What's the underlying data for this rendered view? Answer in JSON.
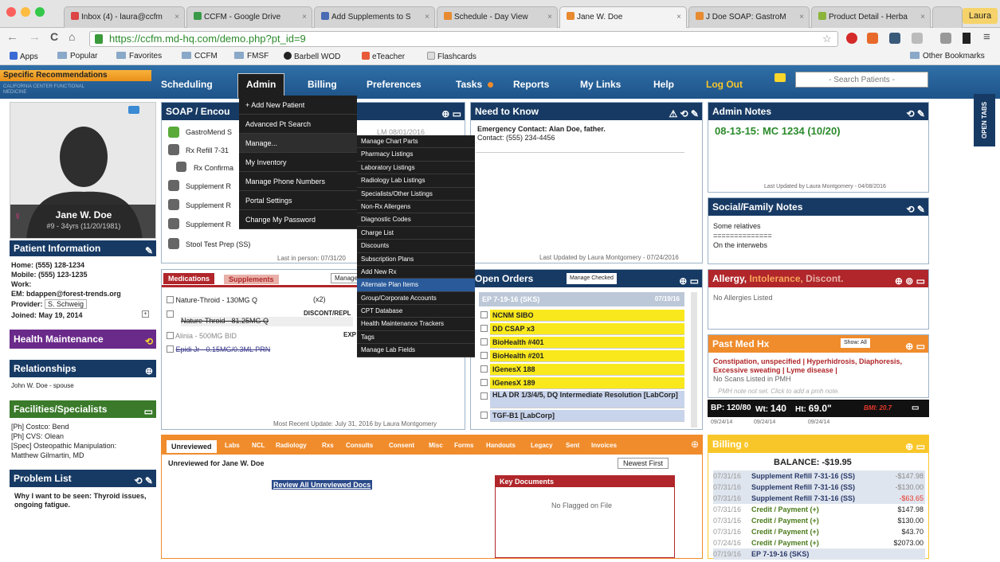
{
  "browser": {
    "tabs": [
      "Inbox (4) - laura@ccfm",
      "CCFM - Google Drive",
      "Add Supplements to S",
      "Schedule - Day View",
      "Jane W. Doe",
      "J Doe SOAP: GastroM",
      "Product Detail - Herba"
    ],
    "profile": "Laura",
    "url": "https://ccfm.md-hq.com/demo.php?pt_id=9"
  },
  "bookmarks": [
    "Apps",
    "Popular",
    "Favorites",
    "CCFM",
    "FMSF",
    "Barbell WOD",
    "eTeacher",
    "Flashcards",
    "Other Bookmarks"
  ],
  "logo": {
    "banner": "Specific Recommendations",
    "sub": "CALIFORNIA CENTER FUNCTIONAL MEDICINE"
  },
  "nav": [
    "Scheduling",
    "Admin",
    "Billing",
    "Preferences",
    "Tasks",
    "Reports",
    "My Links",
    "Help",
    "Log Out"
  ],
  "search_placeholder": "- Search Patients -",
  "open_tabs": "OPEN TABS",
  "patient": {
    "name": "Jane W. Doe",
    "id": "#9 - 34yrs (11/20/1981)"
  },
  "patient_info": {
    "title": "Patient Information",
    "home": "Home: (555) 128-1234",
    "mobile": "Mobile: (555) 123-1235",
    "work": "Work:",
    "em": "EM: bdappen@forest-trends.org",
    "provider_label": "Provider:",
    "provider": "S. Schweig",
    "joined": "Joined: May 19, 2014"
  },
  "health_maintenance": "Health Maintenance",
  "relationships": {
    "title": "Relationships",
    "item": "John W. Doe - spouse"
  },
  "facilities": {
    "title": "Facilities/Specialists",
    "items": [
      "[Ph] Costco: Bend",
      "[Ph] CVS: Olean",
      "[Spec] Osteopathic Manipulation:",
      "Matthew Gilmartin, MD"
    ]
  },
  "problem_list": {
    "title": "Problem List",
    "text": "Why I want to be seen: Thyroid issues, ongoing fatigue."
  },
  "soap": {
    "title": "SOAP / Encou",
    "items": [
      "GastroMend S",
      "Rx Refill 7-31",
      "Rx Confirma",
      "Supplement R",
      "Supplement R",
      "Supplement R",
      "Stool Test Prep (SS)"
    ],
    "date": "LM 08/01/2016",
    "footer": "Last in person: 07/31/20"
  },
  "admin_menu": [
    "+ Add New Patient",
    "Advanced Pt Search",
    "Manage...",
    "My Inventory",
    "Manage Phone Numbers",
    "Portal Settings",
    "Change My Password"
  ],
  "manage_menu": [
    "Manage Chart Parts",
    "Pharmacy Listings",
    "Laboratory Listings",
    "Radiology Lab Listings",
    "Specialists/Other Listings",
    "Non-Rx Allergens",
    "Diagnostic Codes",
    "Charge List",
    "Discounts",
    "Subscription Plans",
    "Add New Rx",
    "Alternate Plan Items",
    "Group/Corporate Accounts",
    "CPT Database",
    "Health Maintenance Trackers",
    "Tags",
    "Manage Lab Fields"
  ],
  "meds": {
    "tabs": [
      "Medications",
      "Supplements"
    ],
    "manage": "Manage",
    "items": [
      "Nature-Throid - 130MG Q",
      "Nature-Throid - 81.25MG Q",
      "Alinia - 500MG BID",
      "Epidi Jr - 0.15MG/0.3ML PRN"
    ],
    "x2": "(x2)",
    "discont": "DISCONT/REPL",
    "exp": "EXP",
    "footer": "Most Recent Update: July 31, 2016 by Laura Montgomery"
  },
  "need_to_know": {
    "title": "Need to Know",
    "contact": "Emergency Contact: Alan Doe, father.",
    "phone": "Contact: (555) 234-4456",
    "footer": "Last Updated by Laura Montgomery - 07/24/2016"
  },
  "admin_notes": {
    "title": "Admin Notes",
    "text": "08-13-15: MC 1234 (10/20)",
    "footer": "Last Updated by Laura Montgomery - 04/08/2016"
  },
  "social": {
    "title": "Social/Family Notes",
    "lines": [
      "Some relatives",
      "==============",
      "On the interwebs"
    ]
  },
  "orders": {
    "title": "Open Orders",
    "manage": "Manage Checked",
    "group": "EP 7-19-16 (SKS)",
    "group_date": "07/19/16",
    "items": [
      "NCNM SIBO",
      "DD CSAP x3",
      "BioHealth #401",
      "BioHealth #201",
      "IGenesX 188",
      "IGenesX 189",
      "HLA DR 1/3/4/5, DQ Intermediate Resolution [LabCorp]",
      "TGF-B1 [LabCorp]"
    ]
  },
  "allergy": {
    "title_a": "Allergy, ",
    "title_b": "Intolerance, ",
    "title_c": "Discont.",
    "text": "No Allergies Listed"
  },
  "pmh": {
    "title": "Past Med Hx",
    "show": "Show: All",
    "text": "Constipation, unspecified | Hyperhidrosis, Diaphoresis, Excessive sweating | Lyme disease |",
    "scans": "No Scans Listed in PMH",
    "note": "PMH note not set. Click to add a pmh note."
  },
  "vitals": {
    "bp": "BP: 120/80",
    "wt_label": "Wt:",
    "wt": "140",
    "ht_label": "Ht:",
    "ht": "69.0\"",
    "bmi": "BMI: 20.7",
    "dates": [
      "09/24/14",
      "09/24/14",
      "09/24/14"
    ]
  },
  "docs": {
    "tabs": [
      "Unreviewed",
      "Labs",
      "NCL",
      "Radiology",
      "Rxs",
      "Consults",
      "Consent",
      "Misc",
      "Forms",
      "Handouts",
      "Legacy",
      "Sent",
      "Invoices"
    ],
    "heading": "Unreviewed for Jane W. Doe",
    "sort": "Newest First",
    "review": "Review All Unreviewed Docs",
    "key_title": "Key Documents",
    "key_empty": "No Flagged on File"
  },
  "billing": {
    "title": "Billing",
    "count": "0",
    "balance": "BALANCE: -$19.95",
    "rows": [
      {
        "d": "07/31/16",
        "t": "Supplement Refill 7-31-16 (SS)",
        "a": "-$147.98"
      },
      {
        "d": "07/31/16",
        "t": "Supplement Refill 7-31-16 (SS)",
        "a": "-$130.00"
      },
      {
        "d": "07/31/16",
        "t": "Supplement Refill 7-31-16 (SS)",
        "a": "-$63.65"
      },
      {
        "d": "07/31/16",
        "t": "Credit / Payment (+)",
        "a": "$147.98"
      },
      {
        "d": "07/31/16",
        "t": "Credit / Payment (+)",
        "a": "$130.00"
      },
      {
        "d": "07/31/16",
        "t": "Credit / Payment (+)",
        "a": "$43.70"
      },
      {
        "d": "07/24/16",
        "t": "Credit / Payment (+)",
        "a": "$2073.00"
      },
      {
        "d": "07/19/16",
        "t": "EP 7-19-16 (SKS)",
        "a": ""
      }
    ]
  }
}
